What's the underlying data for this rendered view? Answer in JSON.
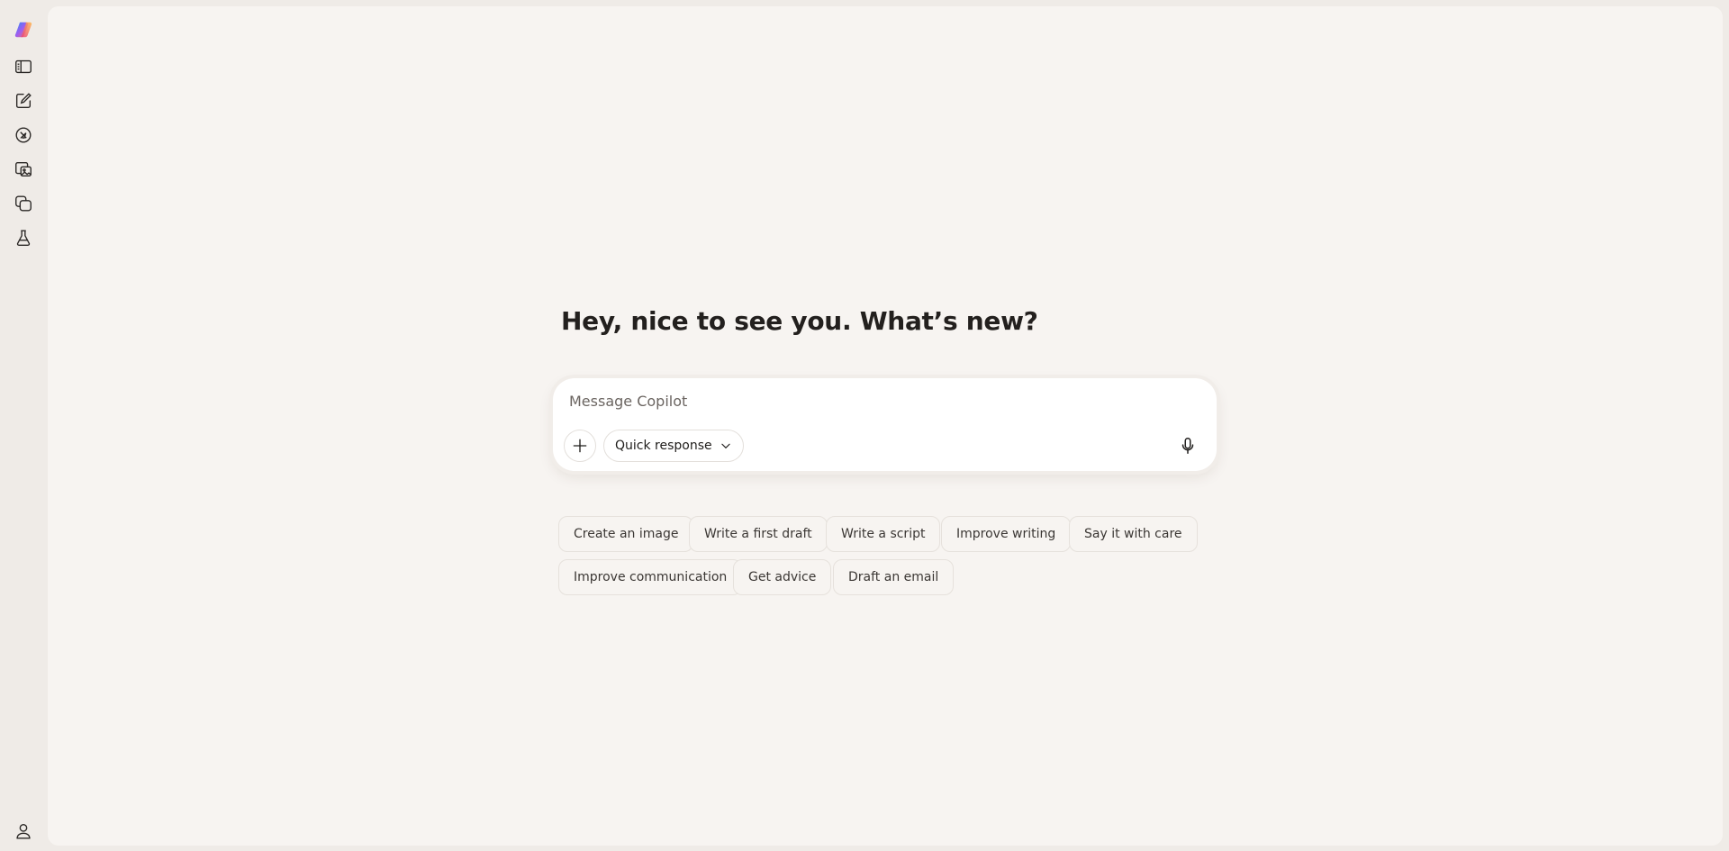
{
  "greeting": "Hey, nice to see you. What’s new?",
  "composer": {
    "placeholder": "Message Copilot",
    "mode_label": "Quick response"
  },
  "suggestions": [
    "Create an image",
    "Write a first draft",
    "Write a script",
    "Improve writing",
    "Say it with care",
    "Improve communication",
    "Get advice",
    "Draft an email"
  ],
  "sidebar": {
    "icons": [
      "copilot-logo",
      "sidebar-toggle-icon",
      "new-chat-icon",
      "discover-icon",
      "image-gallery-icon",
      "pages-icon",
      "labs-icon"
    ],
    "bottom_icon": "profile-icon"
  },
  "colors": {
    "background": "#efebe7",
    "canvas": "#f7f4f1",
    "composer": "#ffffff",
    "text": "#1f1d1b"
  }
}
